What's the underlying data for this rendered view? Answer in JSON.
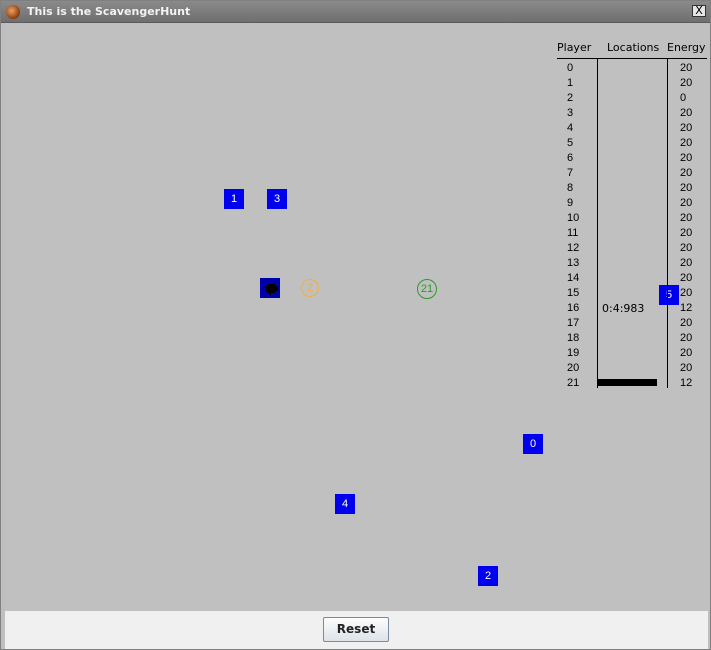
{
  "window": {
    "title": "This is the ScavengerHunt",
    "close_label": "X"
  },
  "colors": {
    "node": "#0000ee",
    "ring_orange": "#f0b040",
    "ring_green": "#2a9a2a",
    "panel": "#c0c0c0"
  },
  "nodes": [
    {
      "label": "1"
    },
    {
      "label": "3"
    },
    {
      "label": "0"
    },
    {
      "label": "4"
    },
    {
      "label": "2"
    },
    {
      "label": "5"
    }
  ],
  "rings": [
    {
      "label": "2"
    },
    {
      "label": "21"
    }
  ],
  "table": {
    "headers": {
      "player": "Player",
      "locations": "Locations",
      "energy": "Energy"
    },
    "players": [
      "0",
      "1",
      "2",
      "3",
      "4",
      "5",
      "6",
      "7",
      "8",
      "9",
      "10",
      "11",
      "12",
      "13",
      "14",
      "15",
      "16",
      "17",
      "18",
      "19",
      "20",
      "21"
    ],
    "energy": [
      "20",
      "20",
      "0",
      "20",
      "20",
      "20",
      "20",
      "20",
      "20",
      "20",
      "20",
      "20",
      "20",
      "20",
      "20",
      "20",
      "12",
      "20",
      "20",
      "20",
      "20",
      "12"
    ],
    "location_16": "0:4:983"
  },
  "footer": {
    "reset_label": "Reset"
  }
}
